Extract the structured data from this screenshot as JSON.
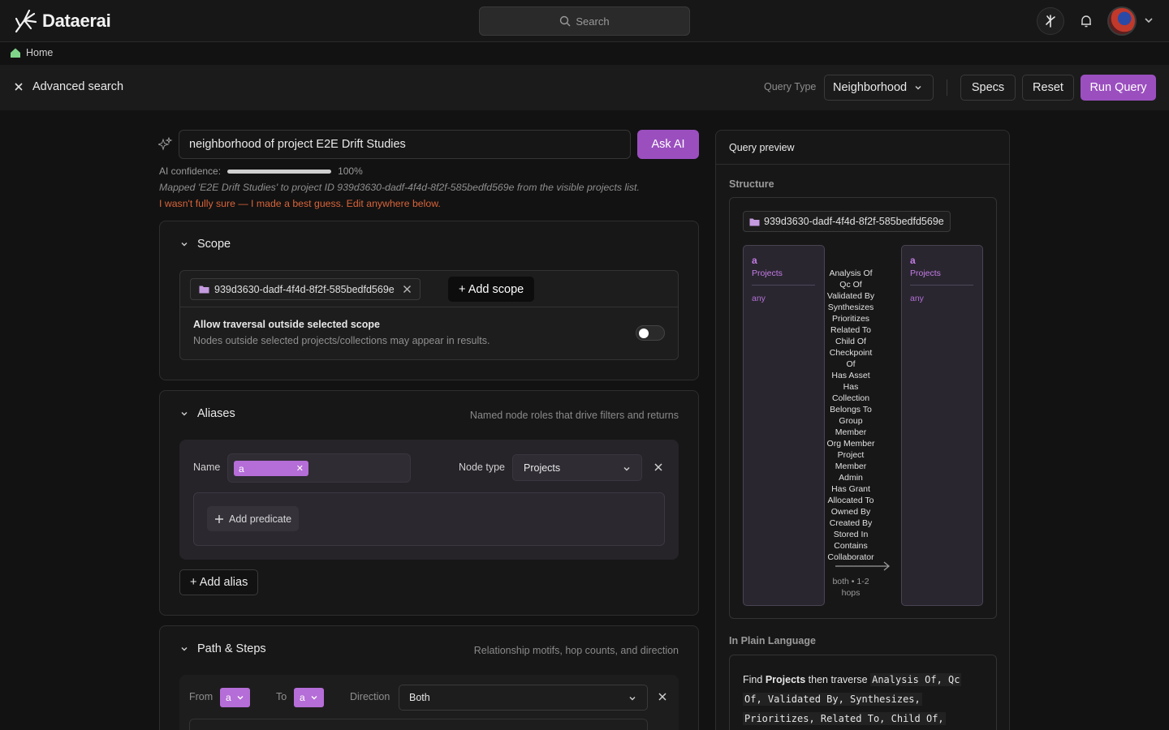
{
  "app": {
    "name": "Dataerai"
  },
  "topbar": {
    "search_placeholder": "Search"
  },
  "breadcrumb": {
    "home": "Home"
  },
  "toolbar": {
    "title": "Advanced search",
    "query_type_label": "Query Type",
    "query_type_value": "Neighborhood",
    "specs": "Specs",
    "reset": "Reset",
    "run": "Run Query"
  },
  "ai": {
    "query": "neighborhood of project E2E Drift Studies",
    "ask_label": "Ask AI",
    "confidence_label": "AI confidence:",
    "confidence_value": 1.0,
    "confidence_text": "100%",
    "mapped_note": "Mapped 'E2E Drift Studies' to project ID 939d3630-dadf-4f4d-8f2f-585bedfd569e from the visible projects list.",
    "guess_note": "I wasn't fully sure — I made a best guess. Edit anywhere below."
  },
  "scope": {
    "title": "Scope",
    "chip": "939d3630-dadf-4f4d-8f2f-585bedfd569e",
    "add_scope": "+ Add scope",
    "traversal_title": "Allow traversal outside selected scope",
    "traversal_sub": "Nodes outside selected projects/collections may appear in results.",
    "traversal_enabled": false
  },
  "aliases": {
    "title": "Aliases",
    "subtitle": "Named node roles that drive filters and returns",
    "name_label": "Name",
    "alias_name": "a",
    "node_type_label": "Node type",
    "node_type_value": "Projects",
    "add_predicate": "Add predicate",
    "add_alias": "+ Add alias"
  },
  "path": {
    "title": "Path & Steps",
    "subtitle": "Relationship motifs, hop counts, and direction",
    "from_label": "From",
    "from_value": "a",
    "to_label": "To",
    "to_value": "a",
    "direction_label": "Direction",
    "direction_value": "Both"
  },
  "preview": {
    "title": "Query preview",
    "structure_label": "Structure",
    "scope_chip": "939d3630-dadf-4f4d-8f2f-585bedfd569e",
    "left_node": {
      "name": "a",
      "type": "Projects",
      "filter": "any"
    },
    "right_node": {
      "name": "a",
      "type": "Projects",
      "filter": "any"
    },
    "relationships": [
      "Analysis Of",
      "Qc Of",
      "Validated By",
      "Synthesizes",
      "Prioritizes",
      "Related To",
      "Child Of",
      "Checkpoint",
      "Of",
      "Has Asset",
      "Has",
      "Collection",
      "Belongs To",
      "Group",
      "Member",
      "Org Member",
      "Project",
      "Member",
      "Admin",
      "Has Grant",
      "Allocated To",
      "Owned By",
      "Created By",
      "Stored In",
      "Contains",
      "Collaborator"
    ],
    "rel_meta_1": "both • 1-2",
    "rel_meta_2": "hops",
    "plain_label": "In Plain Language",
    "plain_find": "Find",
    "plain_entity": "Projects",
    "plain_then": "then traverse",
    "plain_rel_1": "Analysis Of, Qc",
    "plain_rel_2": "Of, Validated By, Synthesizes,",
    "plain_rel_3": "Prioritizes, Related To, Child Of,"
  },
  "colors": {
    "accent": "#9b4fbf",
    "alias_tag": "#b56dd8",
    "warning": "#d9643a"
  },
  "icons": [
    "logo-icon",
    "search-icon",
    "graph-icon",
    "bell-icon",
    "chevron-down-icon",
    "home-icon",
    "close-icon",
    "sparkle-icon",
    "folder-icon",
    "plus-icon",
    "arrow-right-icon"
  ]
}
